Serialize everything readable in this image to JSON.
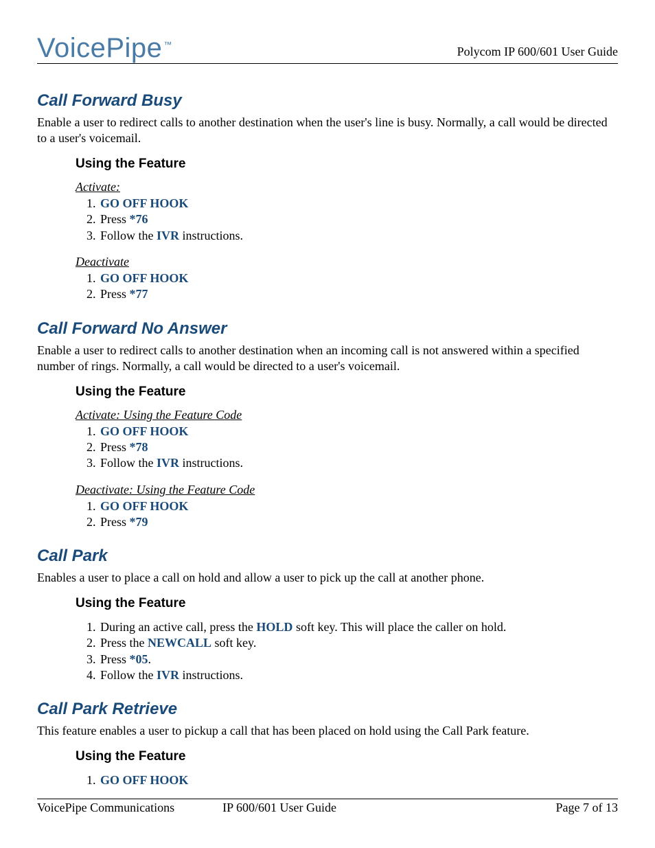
{
  "header": {
    "logo": "VoicePipe",
    "tm": "™",
    "right": "Polycom IP 600/601 User Guide"
  },
  "sections": [
    {
      "title": "Call Forward Busy",
      "para": "Enable a user to redirect calls to another destination when the user's line is busy.  Normally, a call would be directed to a user's voicemail.",
      "subtitle": "Using the Feature",
      "groups": [
        {
          "label": "Activate:",
          "items": [
            {
              "kw": "GO OFF HOOK"
            },
            {
              "pre": "Press ",
              "kw": "*76"
            },
            {
              "pre": "Follow the ",
              "kw": "IVR",
              "post": " instructions."
            }
          ]
        },
        {
          "label": "Deactivate",
          "items": [
            {
              "kw": "GO OFF HOOK"
            },
            {
              "pre": "Press ",
              "kw": "*77"
            }
          ]
        }
      ]
    },
    {
      "title": "Call Forward No Answer",
      "para": "Enable a user to redirect calls to another destination when an incoming call is not answered within a specified number of rings.  Normally, a call would be directed to a user's voicemail.",
      "subtitle": "Using the Feature",
      "groups": [
        {
          "label": "Activate: Using the Feature Code",
          "items": [
            {
              "kw": "GO OFF HOOK"
            },
            {
              "pre": "Press ",
              "kw": "*78"
            },
            {
              "pre": "Follow the ",
              "kw": "IVR",
              "post": " instructions."
            }
          ]
        },
        {
          "label": "Deactivate: Using the Feature Code",
          "items": [
            {
              "kw": "GO OFF HOOK"
            },
            {
              "pre": "Press ",
              "kw": "*79"
            }
          ]
        }
      ]
    },
    {
      "title": "Call Park",
      "para": "Enables a user to place a call on hold and allow a user to pick up the call at another phone.",
      "subtitle": "Using the Feature",
      "groups": [
        {
          "items": [
            {
              "pre": "During an active call, press the ",
              "kw": "HOLD",
              "post": " soft key.  This will place the caller on hold."
            },
            {
              "pre": "Press the ",
              "kw": "NEWCALL",
              "post": " soft key."
            },
            {
              "pre": "Press ",
              "kw": "*05",
              "post": "."
            },
            {
              "pre": "Follow the ",
              "kw": "IVR",
              "post": " instructions."
            }
          ]
        }
      ]
    },
    {
      "title": "Call Park Retrieve",
      "para": "This feature enables a user to pickup a call that has been placed on hold using the Call Park feature.",
      "subtitle": "Using the Feature",
      "groups": [
        {
          "items": [
            {
              "kw": "GO OFF HOOK"
            }
          ]
        }
      ]
    }
  ],
  "footer": {
    "left": "VoicePipe Communications",
    "center": "IP 600/601 User Guide",
    "right": "Page 7 of 13"
  }
}
